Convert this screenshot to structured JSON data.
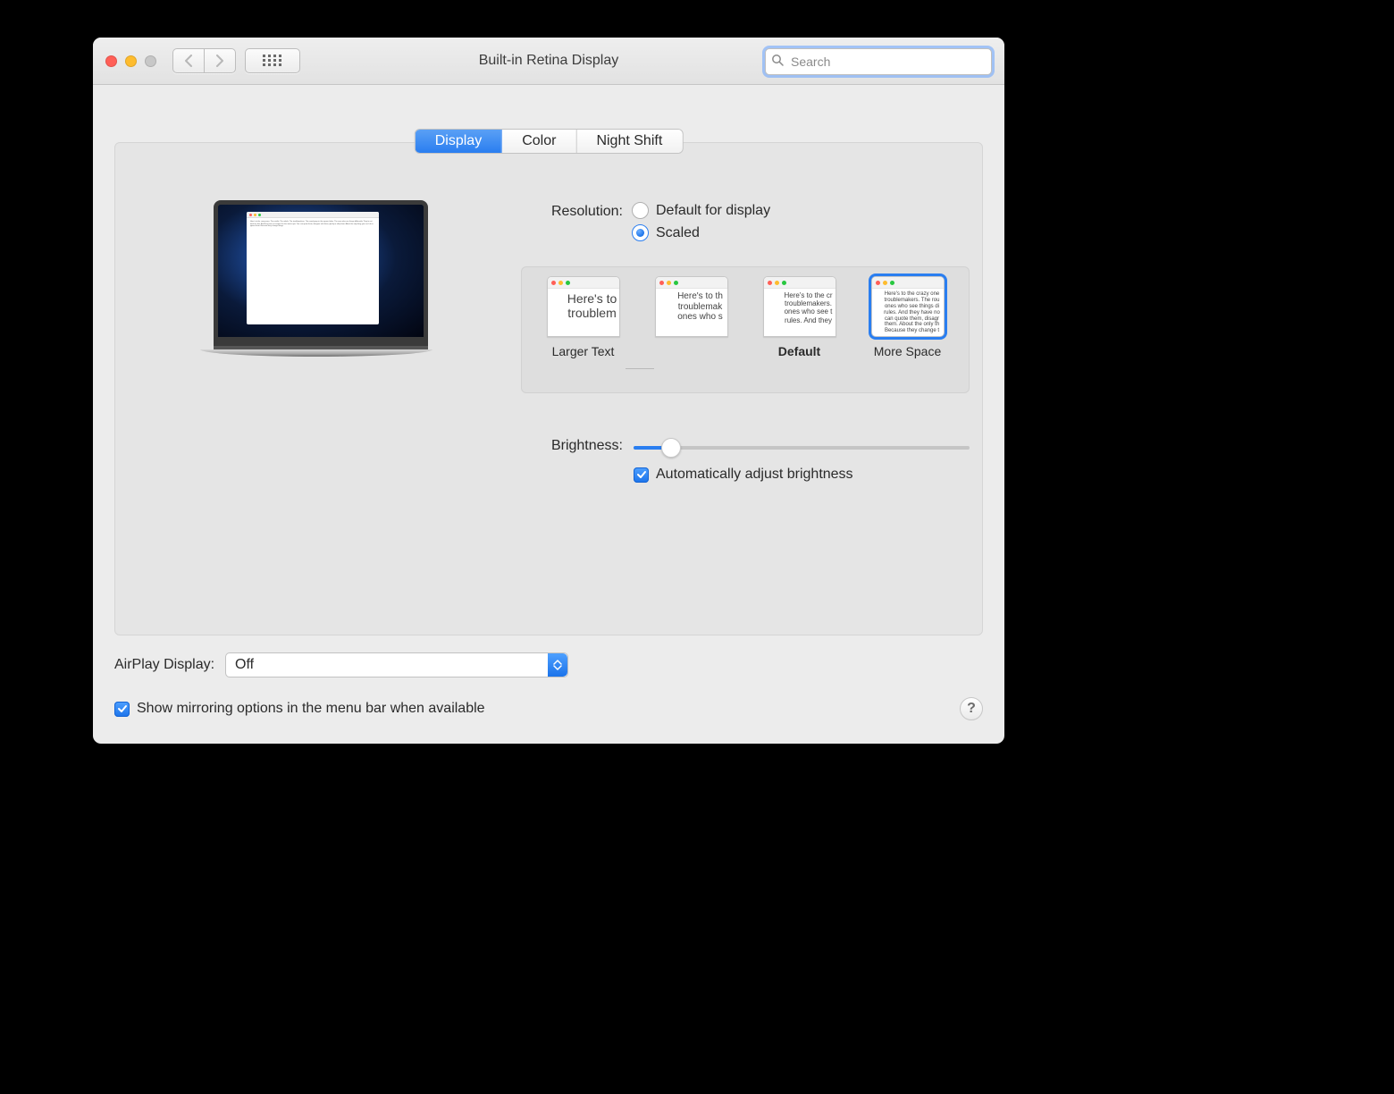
{
  "window": {
    "title": "Built-in Retina Display"
  },
  "search": {
    "placeholder": "Search",
    "value": ""
  },
  "tabs": {
    "display": "Display",
    "color": "Color",
    "night_shift": "Night Shift",
    "selected": "display"
  },
  "resolution": {
    "label": "Resolution:",
    "option_default": "Default for display",
    "option_scaled": "Scaled",
    "selected": "scaled"
  },
  "scale_options": {
    "larger_text": "Larger Text",
    "default": "Default",
    "more_space": "More Space",
    "selected_index": 3,
    "sample_full": "Here's to the crazy ones. The misfits. The rebels. The troublemakers. The round pegs in the square holes. The ones who see things differently. They're not fond of rules. And they have no respect for the status quo. You can quote them, disagree with them, glorify or vilify them. About the only thing you can't do is ignore them. Because they change things."
  },
  "brightness": {
    "label": "Brightness:",
    "value": 11,
    "auto_label": "Automatically adjust brightness",
    "auto_checked": true
  },
  "airplay": {
    "label": "AirPlay Display:",
    "value": "Off"
  },
  "mirroring": {
    "label": "Show mirroring options in the menu bar when available",
    "checked": true
  },
  "help": {
    "glyph": "?"
  }
}
